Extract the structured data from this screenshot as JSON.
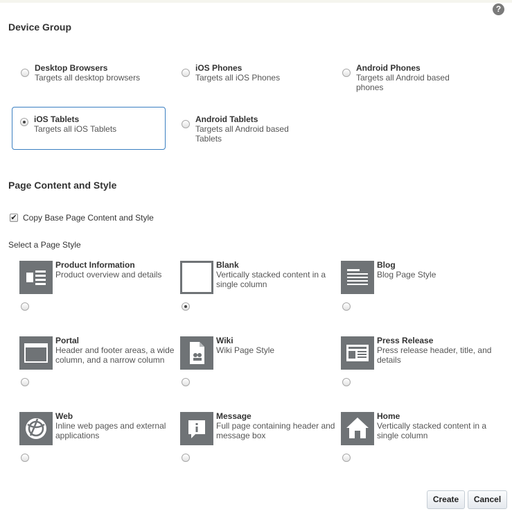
{
  "help_label": "?",
  "device_group": {
    "heading": "Device Group",
    "options": [
      {
        "name": "Desktop Browsers",
        "desc": "Targets all desktop browsers",
        "selected": false
      },
      {
        "name": "iOS Phones",
        "desc": "Targets all iOS Phones",
        "selected": false
      },
      {
        "name": "Android Phones",
        "desc": "Targets all Android based phones",
        "selected": false
      },
      {
        "name": "iOS Tablets",
        "desc": "Targets all iOS Tablets",
        "selected": true
      },
      {
        "name": "Android Tablets",
        "desc": "Targets all Android based Tablets",
        "selected": false
      }
    ]
  },
  "page_content": {
    "heading": "Page Content and Style",
    "copy_checkbox_label": "Copy Base Page Content and Style",
    "copy_checked": true,
    "select_style_label": "Select a Page Style",
    "styles": [
      {
        "name": "Product Information",
        "desc": "Product overview and details",
        "icon": "product-information-icon",
        "selected": false
      },
      {
        "name": "Blank",
        "desc": "Vertically stacked content in a single column",
        "icon": "blank-page-icon",
        "selected": true
      },
      {
        "name": "Blog",
        "desc": "Blog Page Style",
        "icon": "blog-icon",
        "selected": false
      },
      {
        "name": "Portal",
        "desc": "Header and footer areas, a wide column, and a narrow column",
        "icon": "portal-icon",
        "selected": false
      },
      {
        "name": "Wiki",
        "desc": "Wiki Page Style",
        "icon": "wiki-icon",
        "selected": false
      },
      {
        "name": "Press Release",
        "desc": "Press release header, title, and details",
        "icon": "press-release-icon",
        "selected": false
      },
      {
        "name": "Web",
        "desc": "Inline web pages and external applications",
        "icon": "web-icon",
        "selected": false
      },
      {
        "name": "Message",
        "desc": "Full page containing header and message box",
        "icon": "message-icon",
        "selected": false
      },
      {
        "name": "Home",
        "desc": "Vertically stacked content in a single column",
        "icon": "home-icon",
        "selected": false
      }
    ]
  },
  "buttons": {
    "create": "Create",
    "cancel": "Cancel"
  },
  "colors": {
    "accent": "#3a7fc1",
    "thumb": "#6f7376"
  }
}
